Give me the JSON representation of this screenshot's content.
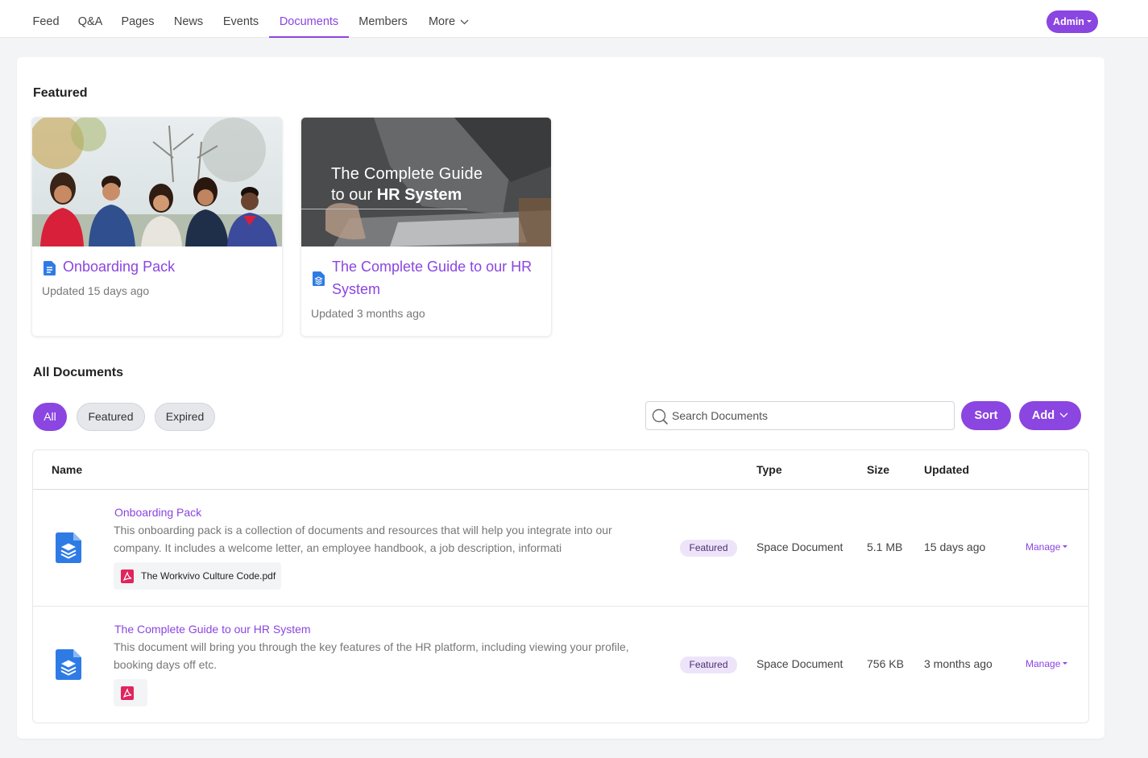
{
  "nav": {
    "items": [
      {
        "label": "Feed"
      },
      {
        "label": "Q&A"
      },
      {
        "label": "Pages"
      },
      {
        "label": "News"
      },
      {
        "label": "Events"
      },
      {
        "label": "Documents"
      },
      {
        "label": "Members"
      },
      {
        "label": "More"
      }
    ],
    "active": "Documents",
    "admin_label": "Admin"
  },
  "featured": {
    "title": "Featured",
    "cards": [
      {
        "title": "Onboarding Pack",
        "updated": "Updated 15 days ago"
      },
      {
        "title": "The Complete Guide to our HR System",
        "updated": "Updated 3 months ago",
        "image_text_line1": "The Complete Guide",
        "image_text_prefix": "to our ",
        "image_text_bold": "HR System"
      }
    ]
  },
  "all_documents": {
    "title": "All Documents",
    "filters": [
      "All",
      "Featured",
      "Expired"
    ],
    "active_filter": "All",
    "search_placeholder": "Search Documents",
    "sort_label": "Sort",
    "add_label": "Add"
  },
  "table": {
    "columns": {
      "name": "Name",
      "type": "Type",
      "size": "Size",
      "updated": "Updated"
    },
    "rows": [
      {
        "title": "Onboarding Pack",
        "description_line1": "This onboarding pack is a collection of documents and resources that will help you integrate into our",
        "description_line2": "company. It includes a welcome letter, an employee handbook, a job description, informati",
        "attachment": "The Workvivo Culture Code.pdf",
        "badge": "Featured",
        "type": "Space Document",
        "size": "5.1 MB",
        "updated": "15 days ago",
        "action": "Manage"
      },
      {
        "title": "The Complete Guide to our HR System",
        "description_line1": "This document will bring you through the key features of the HR platform, including viewing your profile,",
        "description_line2": "booking days off etc.",
        "attachment": "",
        "badge": "Featured",
        "type": "Space Document",
        "size": "756 KB",
        "updated": "3 months ago",
        "action": "Manage"
      }
    ]
  },
  "colors": {
    "accent": "#8b45e0",
    "doc_icon": "#2f7be5",
    "pdf_icon": "#e0245e"
  }
}
